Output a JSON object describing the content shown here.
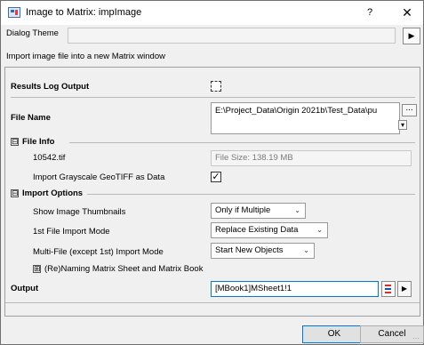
{
  "window": {
    "title": "Image to Matrix: impImage",
    "help_glyph": "?",
    "close_glyph": "✕"
  },
  "dialog_theme": {
    "label": "Dialog Theme",
    "value": "",
    "arrow_glyph": "▶"
  },
  "description": "Import image file into a new Matrix window",
  "results_log": {
    "label": "Results Log Output",
    "checked": false
  },
  "file_name": {
    "label": "File Name",
    "value": "E:\\Project_Data\\Origin 2021b\\Test_Data\\pu",
    "browse_glyph": "...",
    "dropdown_glyph": "▾"
  },
  "file_info": {
    "expander": "⊟",
    "label": "File Info",
    "file_label": "10542.tif",
    "file_size": "File Size: 138.19 MB",
    "grayscale_label": "Import Grayscale GeoTIFF as Data",
    "grayscale_check": "✓"
  },
  "import_options": {
    "expander": "⊟",
    "label": "Import Options",
    "thumbnails": {
      "label": "Show Image Thumbnails",
      "value": "Only if Multiple"
    },
    "first_mode": {
      "label": "1st File Import Mode",
      "value": "Replace Existing Data"
    },
    "multi_mode": {
      "label": "Multi-File (except 1st) Import Mode",
      "value": "Start New Objects"
    },
    "renaming": {
      "expander": "⊞",
      "label": "(Re)Naming Matrix Sheet and Matrix Book"
    }
  },
  "output": {
    "label": "Output",
    "value": "[MBook1]MSheet1!1",
    "arrow_glyph": "▶"
  },
  "buttons": {
    "ok": "OK",
    "cancel": "Cancel"
  },
  "colors": {
    "accent": "#0078d7",
    "dialog_bg": "#f0f0f0",
    "title_bg": "#ffffff"
  }
}
